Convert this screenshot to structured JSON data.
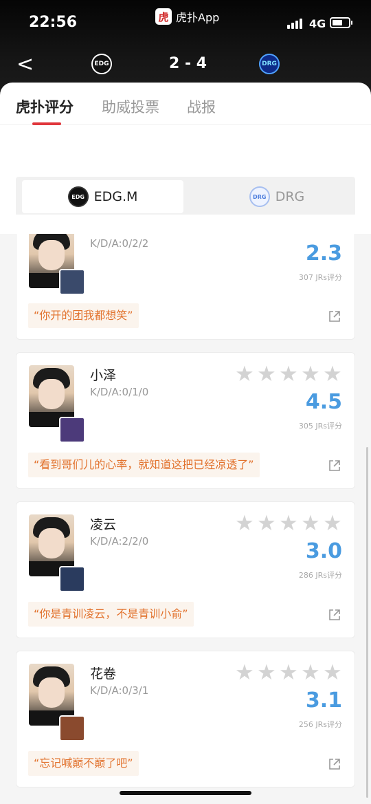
{
  "status": {
    "time": "22:56",
    "app_badge_char": "虎",
    "app_name": "虎扑App",
    "network": "4G"
  },
  "header": {
    "back_glyph": "<",
    "home_logo": "EDG",
    "away_logo": "DRG",
    "score": "2 - 4"
  },
  "tabs": [
    {
      "label": "虎扑评分"
    },
    {
      "label": "助威投票"
    },
    {
      "label": "战报"
    }
  ],
  "teams": [
    {
      "name": "EDG.M",
      "logo": "EDG"
    },
    {
      "name": "DRG",
      "logo": "DRG"
    }
  ],
  "players": [
    {
      "name": "",
      "kda": "K/D/A:0/2/2",
      "rating": "2.3",
      "votes": "307 JRs评分",
      "quote": "“你开的团我都想笑”",
      "hero_color": "#3a4a6b"
    },
    {
      "name": "小泽",
      "kda": "K/D/A:0/1/0",
      "rating": "4.5",
      "votes": "305 JRs评分",
      "quote": "“看到哥们儿的心率，就知道这把已经凉透了”",
      "hero_color": "#4c3a7a"
    },
    {
      "name": "凌云",
      "kda": "K/D/A:2/2/0",
      "rating": "3.0",
      "votes": "286 JRs评分",
      "quote": "“你是青训凌云，不是青训小俞”",
      "hero_color": "#2a3b5e"
    },
    {
      "name": "花卷",
      "kda": "K/D/A:0/3/1",
      "rating": "3.1",
      "votes": "256 JRs评分",
      "quote": "“忘记喊巅不巅了吧”",
      "hero_color": "#8a4a2e"
    }
  ],
  "accent_color": "#e0363c",
  "rating_color": "#4a9be0",
  "quote_color": "#e2722d"
}
